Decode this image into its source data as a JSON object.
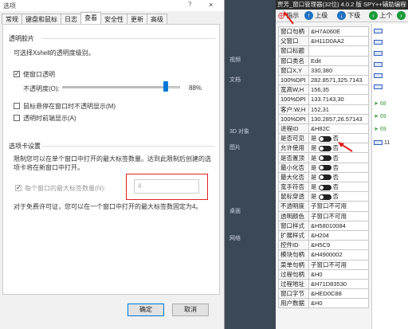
{
  "dialog": {
    "title": "选项",
    "help_glyph": "?",
    "close_glyph": "×",
    "tabs": [
      "常规",
      "键盘和鼠标",
      "日志",
      "查看",
      "安全性",
      "更新",
      "高级"
    ],
    "active_tab": 3,
    "transparency_heading": "透明胶片",
    "transparency_desc": "可选择Xshell的透明度级别。",
    "use_transparency_label": "使窗口透明",
    "opacity_label": "不透明度(O):",
    "opacity_value": "88%",
    "opacity_fraction": 0.88,
    "hover_opaque_label": "鼠标悬停在窗口时不透明显示(M)",
    "opaque_on_top_label": "透明时前端显示(A)",
    "tab_heading": "选项卡设置",
    "tab_desc": "限制您可以在单个窗口中打开的最大标签数量。达到此限制后创建的选项卡将在新窗口中打开。",
    "max_tabs_label": "每个窗口的最大标签数量(N):",
    "max_tabs_value": "4",
    "free_license_note": "对于免费许可证，您可以在一个窗口中打开的最大标签数固定为4。",
    "ok_label": "确定",
    "cancel_label": "取消"
  },
  "middle": {
    "items": [
      "视频",
      "文档",
      "3D 对象",
      "图片",
      "桌面",
      "网络"
    ]
  },
  "spy": {
    "title": "贾芳_窗口管理器(32位) 4.0.2 版 SPY++辅助编程",
    "toolbar": {
      "pointer_label": "指示",
      "up_label": "上级",
      "down_label": "下级",
      "prev_label": "上个"
    },
    "rows": [
      {
        "k": "窗口句柄",
        "v": "&H7A060E"
      },
      {
        "k": "父窗口",
        "v": "&H11D0AA2"
      },
      {
        "k": "窗口标题",
        "v": ""
      },
      {
        "k": "窗口类名",
        "v": "Edit"
      },
      {
        "k": "窗口X,Y",
        "v": "330,380"
      },
      {
        "k": "100%DPI",
        "v": "282.8571,325.7143"
      },
      {
        "k": "宽高W,H",
        "v": "156,35"
      },
      {
        "k": "100%DPI",
        "v": "133.7143,30"
      },
      {
        "k": "客户:W,H",
        "v": "152,31"
      },
      {
        "k": "100%DPI",
        "v": "130.2857,26.57143"
      },
      {
        "k": "进程ID",
        "v": "&H82C"
      },
      {
        "k": "是否可见",
        "v": "是  否",
        "toggle": true
      },
      {
        "k": "允许使用",
        "v": "是  否",
        "toggle": true
      },
      {
        "k": "是否置顶",
        "v": "是  否",
        "toggle": true
      },
      {
        "k": "最小化否",
        "v": "是  否",
        "toggle": true
      },
      {
        "k": "最大化否",
        "v": "是  否",
        "toggle": true
      },
      {
        "k": "宽手符否",
        "v": "是  否",
        "toggle": true
      },
      {
        "k": "鼠标穿透",
        "v": "是  否",
        "toggle": true
      },
      {
        "k": "不透明度",
        "v": "子窗口不可用"
      },
      {
        "k": "透明颜色",
        "v": "子窗口不可用"
      },
      {
        "k": "窗口样式",
        "v": "&H58010084"
      },
      {
        "k": "扩展样式",
        "v": "&H204"
      },
      {
        "k": "控件ID",
        "v": "&H5C9"
      },
      {
        "k": "模块句柄",
        "v": "&H4900002"
      },
      {
        "k": "菜单句柄",
        "v": "子窗口不可用"
      },
      {
        "k": "过程句柄",
        "v": "&H0"
      },
      {
        "k": "过程地址",
        "v": "&H71D83530"
      },
      {
        "k": "窗口字节",
        "v": "&HED0C88"
      },
      {
        "k": "用户数据",
        "v": "&H0"
      }
    ],
    "tree_labels": [
      "68",
      "69",
      "69",
      "11"
    ]
  }
}
